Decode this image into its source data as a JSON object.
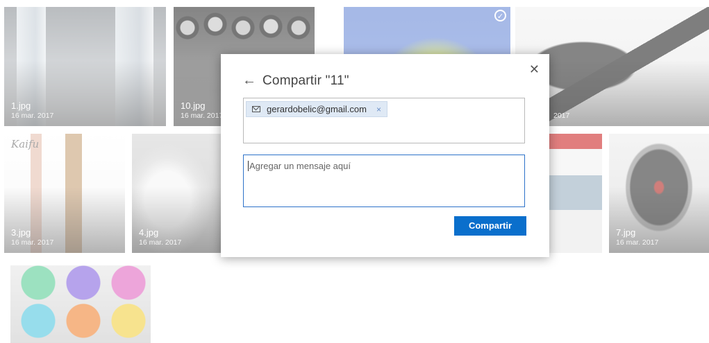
{
  "gallery": {
    "tiles": [
      {
        "name": "1.jpg",
        "date": "16 mar. 2017"
      },
      {
        "name": "10.jpg",
        "date": "16 mar. 2017"
      },
      {
        "name": "11",
        "date": "",
        "selected": true
      },
      {
        "name": "",
        "date": "2017"
      },
      {
        "name": "3.jpg",
        "date": "16 mar. 2017",
        "brand_text": "Kaifu"
      },
      {
        "name": "4.jpg",
        "date": "16 mar. 2017"
      },
      {
        "name": "",
        "date": ""
      },
      {
        "name": "7.jpg",
        "date": "16 mar. 2017"
      },
      {
        "name": "",
        "date": ""
      }
    ]
  },
  "dialog": {
    "title": "Compartir \"11\"",
    "back_icon": "arrow-left-icon",
    "close_icon": "close-icon",
    "recipient": {
      "email": "gerardobelic@gmail.com",
      "icon": "mail-icon",
      "remove_glyph": "×"
    },
    "message": {
      "placeholder": "Agregar un mensaje aquí"
    },
    "share_button": "Compartir",
    "accent_color": "#0a6fcc"
  }
}
